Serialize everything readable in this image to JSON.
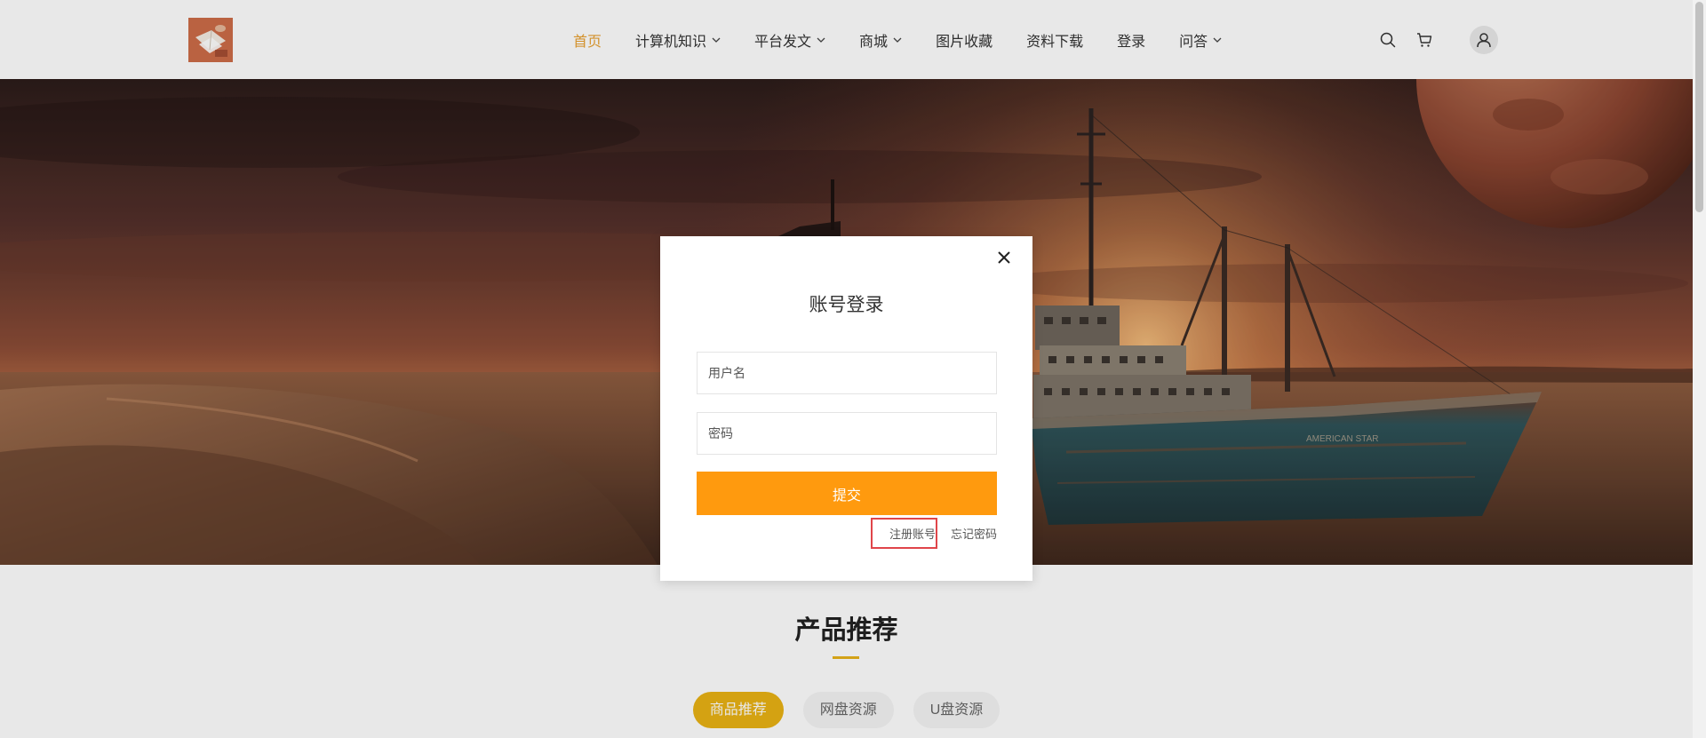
{
  "nav": {
    "items": [
      {
        "label": "首页",
        "active": true
      },
      {
        "label": "计算机知识",
        "dropdown": true
      },
      {
        "label": "平台发文",
        "dropdown": true
      },
      {
        "label": "商城",
        "dropdown": true
      },
      {
        "label": "图片收藏"
      },
      {
        "label": "资料下载"
      },
      {
        "label": "登录"
      },
      {
        "label": "问答",
        "dropdown": true
      }
    ]
  },
  "header_icons": [
    "search-icon",
    "cart-icon",
    "user-avatar-icon"
  ],
  "hero": {
    "ship_hull_text": "AMERICAN STAR"
  },
  "modal": {
    "title": "账号登录",
    "username_placeholder": "用户名",
    "password_placeholder": "密码",
    "submit_label": "提交",
    "register_link": "注册账号",
    "forgot_link": "忘记密码",
    "close_icon": "close-icon"
  },
  "section": {
    "title": "产品推荐",
    "tabs": [
      {
        "label": "商品推荐",
        "active": true
      },
      {
        "label": "网盘资源",
        "active": false
      },
      {
        "label": "U盘资源",
        "active": false
      }
    ]
  },
  "colors": {
    "accent": "#e8a030",
    "submit_button": "#ff9a0e",
    "tab_active": "#eab214",
    "highlight_outline": "#e0454a"
  }
}
